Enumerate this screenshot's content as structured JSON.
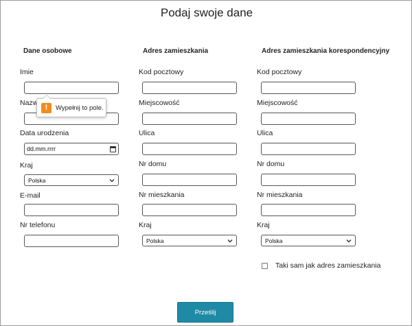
{
  "page": {
    "title": "Podaj swoje dane"
  },
  "personal": {
    "heading": "Dane osobowe",
    "imie_label": "Imie",
    "imie_value": "",
    "nazwisko_label": "Nazwisko",
    "nazwisko_value": "",
    "dob_label": "Data urodzenia",
    "dob_value": "dd.mm.rrrr",
    "kraj_label": "Kraj",
    "kraj_value": "Polska",
    "email_label": "E-mail",
    "email_value": "",
    "phone_label": "Nr telefonu",
    "phone_value": ""
  },
  "address": {
    "heading": "Adres zamieszkania",
    "kod_label": "Kod pocztowy",
    "miejscowosc_label": "Miejscowość",
    "ulica_label": "Ulica",
    "nr_domu_label": "Nr domu",
    "nr_mieszkania_label": "Nr mieszkania",
    "kraj_label": "Kraj",
    "kraj_value": "Polska"
  },
  "correspondence": {
    "heading": "Adres zamieszkania korespondencyjny",
    "kod_label": "Kod pocztowy",
    "miejscowosc_label": "Miejscowość",
    "ulica_label": "Ulica",
    "nr_domu_label": "Nr domu",
    "nr_mieszkania_label": "Nr mieszkania",
    "kraj_label": "Kraj",
    "kraj_value": "Polska",
    "same_checkbox_label": "Taki sam jak adres zamieszkania",
    "same_checked": false
  },
  "submit": {
    "label": "Prześlij"
  },
  "tooltip": {
    "message": "Wypełnij to pole.",
    "icon": "warning-icon"
  },
  "colors": {
    "submit_bg": "#1f8aa6",
    "warning": "#f28c1b"
  }
}
